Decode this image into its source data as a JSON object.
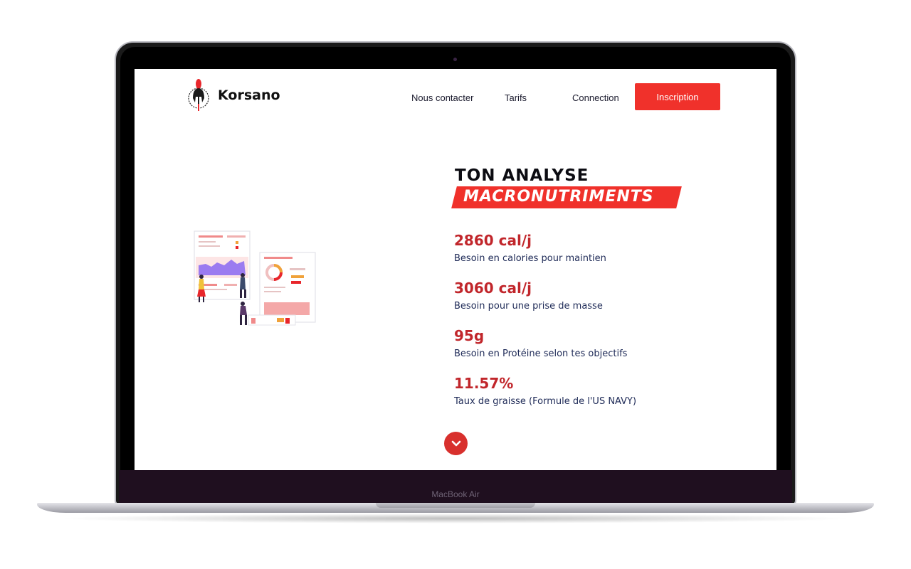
{
  "device": {
    "model_label": "MacBook Air"
  },
  "header": {
    "brand": "Korsano",
    "nav": {
      "contact": "Nous contacter",
      "tarifs": "Tarifs",
      "connection": "Connection",
      "signup": "Inscription"
    }
  },
  "hero": {
    "title_line1": "TON ANALYSE",
    "title_line2": "MACRONUTRIMENTS",
    "stats": [
      {
        "value": "2860 cal/j",
        "label": "Besoin en calories pour maintien"
      },
      {
        "value": "3060 cal/j",
        "label": "Besoin pour une prise de masse"
      },
      {
        "value": "95g",
        "label": "Besoin en Protéine selon tes objectifs"
      },
      {
        "value": "11.57%",
        "label": "Taux de graisse (Formule de l'US NAVY)"
      }
    ],
    "scroll_icon": "chevron-down-icon"
  },
  "colors": {
    "accent": "#f0312b",
    "value_red": "#c1262b",
    "label_navy": "#1e2a57",
    "illustration_purple": "#9b7bf0"
  }
}
